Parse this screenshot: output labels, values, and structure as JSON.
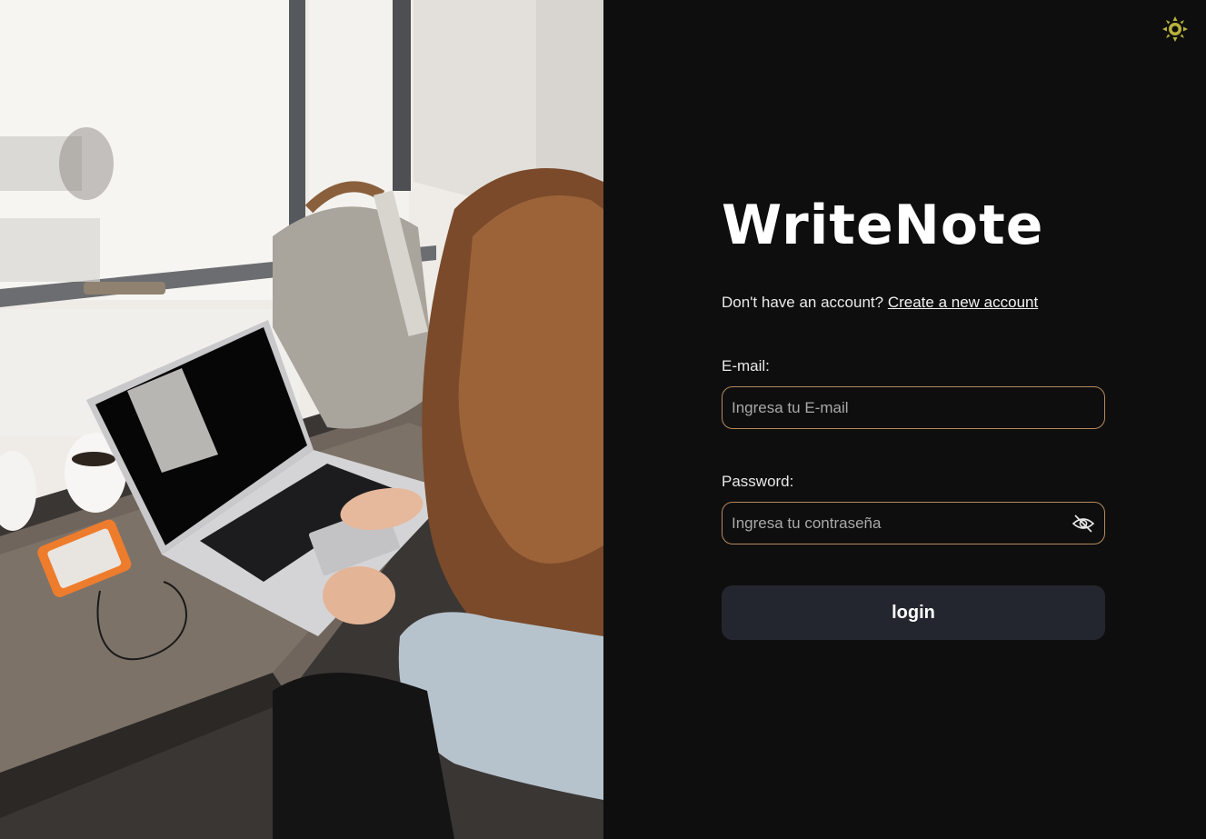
{
  "hero_image": {
    "description_icon": "photo-woman-using-laptop"
  },
  "theme_toggle": {
    "icon": "sun-icon",
    "color": "#b8b23a"
  },
  "login": {
    "title": "WriteNote",
    "signup_prompt": "Don't have an account?",
    "signup_link": "Create a new account",
    "email_label": "E-mail:",
    "email_placeholder": "Ingresa tu E-mail",
    "email_value": "",
    "password_label": "Password:",
    "password_placeholder": "Ingresa tu contraseña",
    "password_value": "",
    "password_visibility_icon": "eye-off-icon",
    "submit_label": "login"
  },
  "colors": {
    "background": "#0e0e0f",
    "input_border": "#b58a5c",
    "button_bg": "#24262f",
    "text": "#ffffff"
  }
}
